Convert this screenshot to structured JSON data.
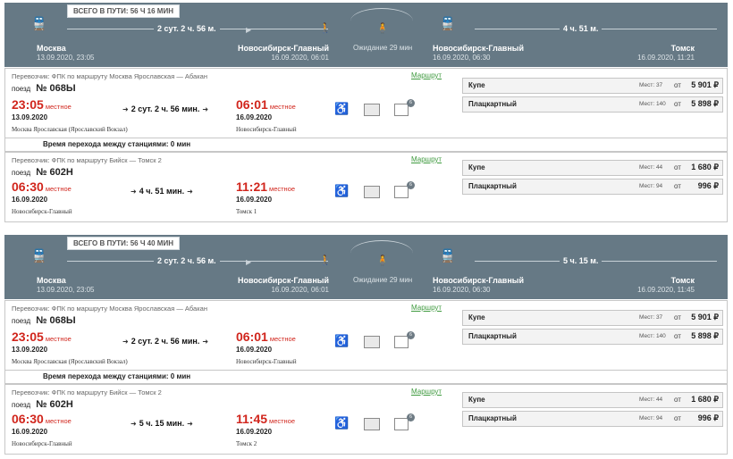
{
  "routes": [
    {
      "total": "ВСЕГО В ПУТИ: 56 Ч 16 МИН",
      "dur1": "2 сут. 2 ч. 56 м.",
      "dur2": "4 ч. 51 м.",
      "wait": "Ожидание 29 мин",
      "from": {
        "name": "Москва",
        "dt": "13.09.2020, 23:05"
      },
      "mid_arr": {
        "name": "Новосибирск-Главный",
        "dt": "16.09.2020, 06:01"
      },
      "mid_dep": {
        "name": "Новосибирск-Главный",
        "dt": "16.09.2020, 06:30"
      },
      "to": {
        "name": "Томск",
        "dt": "16.09.2020, 11:21"
      },
      "seg1": {
        "carrier": "Перевозчик: ФПК    по маршруту Москва Ярославская — Абакан",
        "link": "Маршрут",
        "train_label": "поезд",
        "train": "№ 068Ы",
        "dep_time": "23:05",
        "local": "местное",
        "dep_date": "13.09.2020",
        "dep_station": "Москва Ярославская (Ярославский Вокзал)",
        "travel": "2 сут. 2 ч. 56 мин.",
        "arr_time": "06:01",
        "arr_date": "16.09.2020",
        "arr_station": "Новосибирск-Главный",
        "badge": "6",
        "seats": [
          {
            "name": "Купе",
            "count": "Мест: 37",
            "from": "от",
            "price": "5 901 ₽"
          },
          {
            "name": "Плацкартный",
            "count": "Мест: 140",
            "from": "от",
            "price": "5 898 ₽"
          }
        ]
      },
      "transfer": "Время перехода между станциями: 0 мин",
      "seg2": {
        "carrier": "Перевозчик: ФПК    по маршруту Бийск — Томск 2",
        "link": "Маршрут",
        "train_label": "поезд",
        "train": "№ 602Н",
        "dep_time": "06:30",
        "local": "местное",
        "dep_date": "16.09.2020",
        "dep_station": "Новосибирск-Главный",
        "travel": "4 ч. 51 мин.",
        "arr_time": "11:21",
        "arr_date": "16.09.2020",
        "arr_station": "Томск 1",
        "badge": "6",
        "seats": [
          {
            "name": "Купе",
            "count": "Мест: 44",
            "from": "от",
            "price": "1 680 ₽"
          },
          {
            "name": "Плацкартный",
            "count": "Мест: 94",
            "from": "от",
            "price": "996 ₽"
          }
        ]
      }
    },
    {
      "total": "ВСЕГО В ПУТИ: 56 Ч 40 МИН",
      "dur1": "2 сут. 2 ч. 56 м.",
      "dur2": "5 ч. 15 м.",
      "wait": "Ожидание 29 мин",
      "from": {
        "name": "Москва",
        "dt": "13.09.2020, 23:05"
      },
      "mid_arr": {
        "name": "Новосибирск-Главный",
        "dt": "16.09.2020, 06:01"
      },
      "mid_dep": {
        "name": "Новосибирск-Главный",
        "dt": "16.09.2020, 06:30"
      },
      "to": {
        "name": "Томск",
        "dt": "16.09.2020, 11:45"
      },
      "seg1": {
        "carrier": "Перевозчик: ФПК    по маршруту Москва Ярославская — Абакан",
        "link": "Маршрут",
        "train_label": "поезд",
        "train": "№ 068Ы",
        "dep_time": "23:05",
        "local": "местное",
        "dep_date": "13.09.2020",
        "dep_station": "Москва Ярославская (Ярославский Вокзал)",
        "travel": "2 сут. 2 ч. 56 мин.",
        "arr_time": "06:01",
        "arr_date": "16.09.2020",
        "arr_station": "Новосибирск-Главный",
        "badge": "6",
        "seats": [
          {
            "name": "Купе",
            "count": "Мест: 37",
            "from": "от",
            "price": "5 901 ₽"
          },
          {
            "name": "Плацкартный",
            "count": "Мест: 140",
            "from": "от",
            "price": "5 898 ₽"
          }
        ]
      },
      "transfer": "Время перехода между станциями: 0 мин",
      "seg2": {
        "carrier": "Перевозчик: ФПК    по маршруту Бийск — Томск 2",
        "link": "Маршрут",
        "train_label": "поезд",
        "train": "№ 602Н",
        "dep_time": "06:30",
        "local": "местное",
        "dep_date": "16.09.2020",
        "dep_station": "Новосибирск-Главный",
        "travel": "5 ч. 15 мин.",
        "arr_time": "11:45",
        "arr_date": "16.09.2020",
        "arr_station": "Томск 2",
        "badge": "6",
        "seats": [
          {
            "name": "Купе",
            "count": "Мест: 44",
            "from": "от",
            "price": "1 680 ₽"
          },
          {
            "name": "Плацкартный",
            "count": "Мест: 94",
            "from": "от",
            "price": "996 ₽"
          }
        ]
      }
    }
  ]
}
